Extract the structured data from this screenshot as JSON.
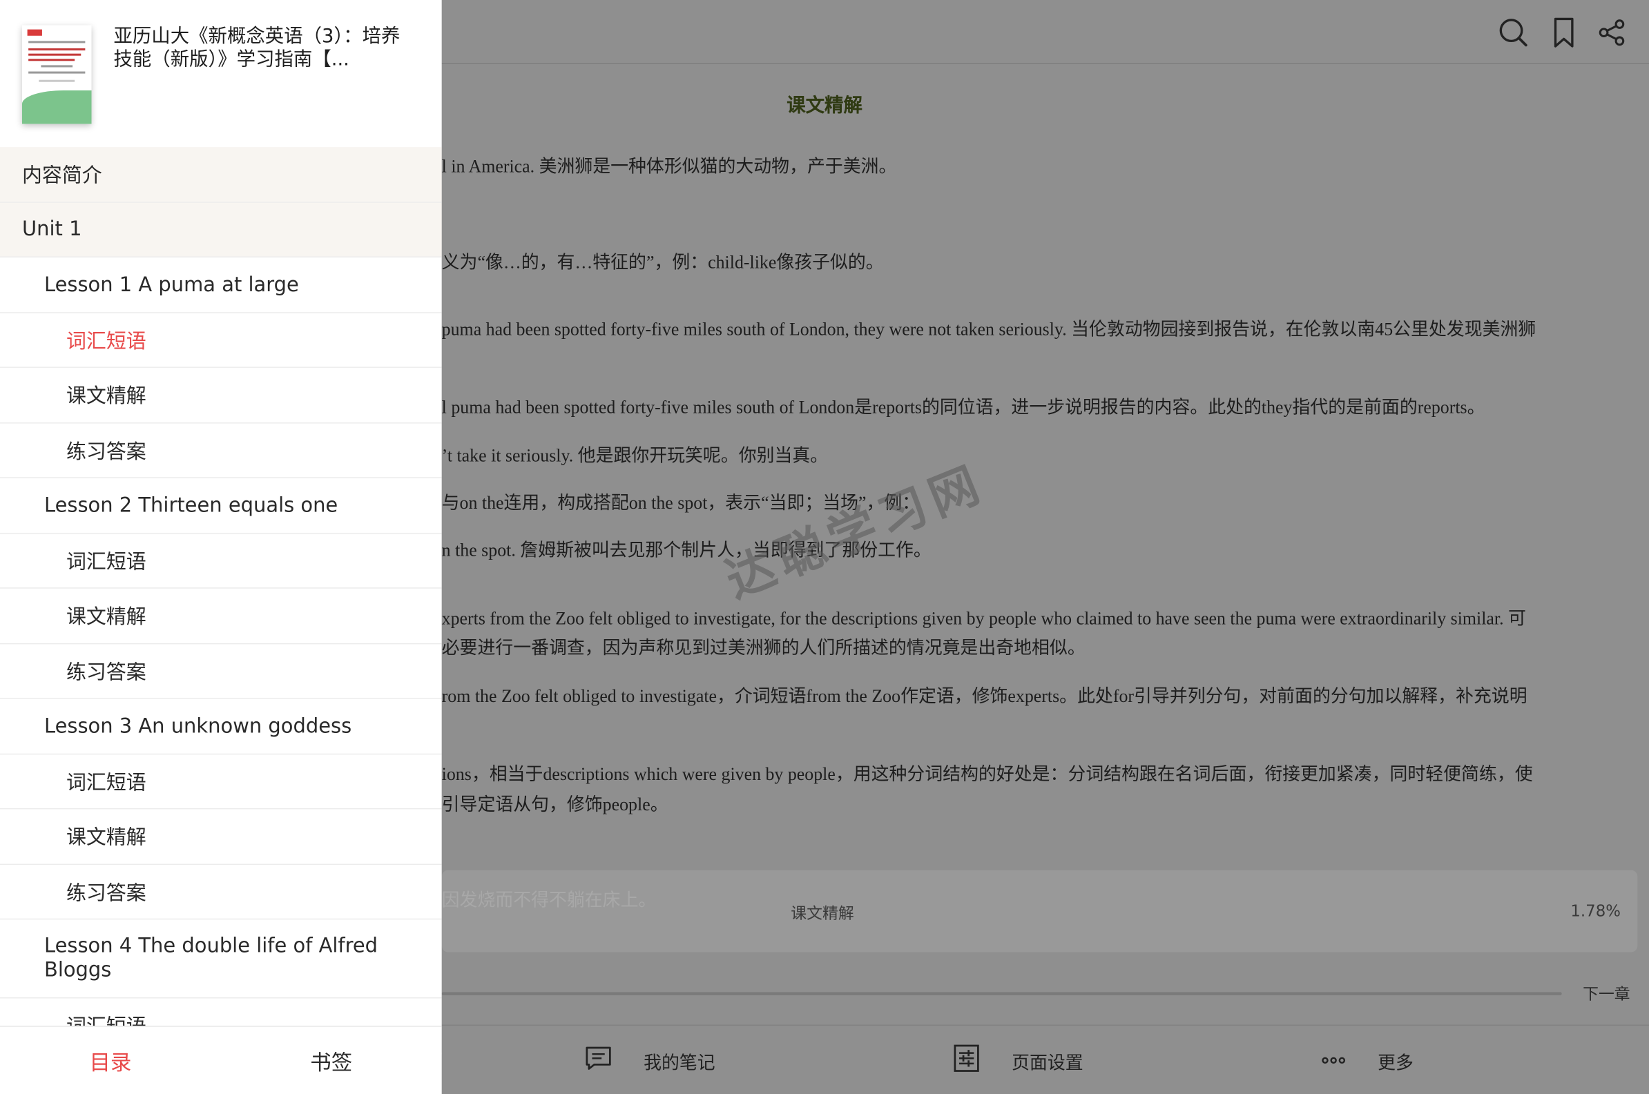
{
  "reader": {
    "chapter_title": "课文精解",
    "paragraphs": [
      "l in America. 美洲狮是一种体形似猫的大动物，产于美洲。",
      "义为“像…的，有…特征的”，例：child-like像孩子似的。",
      "puma had been spotted forty-five miles south of London, they were not taken seriously. 当伦敦动物园接到报告说，在伦敦以南45公里处发现美洲狮",
      "l puma had been spotted forty-five miles south of London是reports的同位语，进一步说明报告的内容。此处的they指代的是前面的reports。",
      "’t take it seriously. 他是跟你开玩笑呢。你别当真。",
      "与on the连用，构成搭配on the spot，表示“当即；当场”，例：",
      "n the spot. 詹姆斯被叫去见那个制片人，当即得到了那份工作。",
      "xperts from the Zoo felt obliged to investigate, for the descriptions given by people who claimed to have seen the puma were extraordinarily similar. 可",
      "必要进行一番调查，因为声称见到过美洲狮的人们所描述的情况竟是出奇地相似。",
      "rom the Zoo felt obliged to investigate，介词短语from the Zoo作定语，修饰experts。此处for引导并列分句，对前面的分句加以解释，补充说明",
      "ions，相当于descriptions which were given by people，用这种分词结构的好处是：分词结构跟在名词后面，衔接更加紧凑，同时轻便简练，使",
      "引导定语从句，修饰people。"
    ],
    "watermark": "达聪学习网",
    "info_card": {
      "faint_text": "因发烧而不得不躺在床上。",
      "chapter": "课文精解",
      "progress": "1.78%"
    },
    "next_chapter": "下一章",
    "bottom_bar": {
      "notes": "我的笔记",
      "page_settings": "页面设置",
      "more": "更多"
    }
  },
  "drawer": {
    "book_title": "亚历山大《新概念英语（3）：培养技能（新版）》学习指南【...",
    "toc": [
      {
        "label": "内容简介",
        "level": 0
      },
      {
        "label": "Unit 1",
        "level": 0
      },
      {
        "label": "Lesson 1 A puma at large",
        "level": 1
      },
      {
        "label": "词汇短语",
        "level": 2,
        "active": true
      },
      {
        "label": "课文精解",
        "level": 2
      },
      {
        "label": "练习答案",
        "level": 2
      },
      {
        "label": "Lesson 2 Thirteen equals one",
        "level": 1
      },
      {
        "label": "词汇短语",
        "level": 2
      },
      {
        "label": "课文精解",
        "level": 2
      },
      {
        "label": "练习答案",
        "level": 2
      },
      {
        "label": "Lesson 3 An unknown goddess",
        "level": 1
      },
      {
        "label": "词汇短语",
        "level": 2
      },
      {
        "label": "课文精解",
        "level": 2
      },
      {
        "label": "练习答案",
        "level": 2
      },
      {
        "label": "Lesson 4 The double life of Alfred Bloggs",
        "level": 1,
        "tall": true
      },
      {
        "label": "词汇短语",
        "level": 2
      }
    ],
    "footer": {
      "contents": "目录",
      "bookmarks": "书签"
    }
  },
  "colors": {
    "accent": "#e84a4a",
    "overlay": "#8f8f8f",
    "section_bg": "#f8f5f1"
  },
  "icons": [
    "search-icon",
    "bookmark-icon",
    "share-icon",
    "notes-icon",
    "settings-icon",
    "more-icon"
  ]
}
